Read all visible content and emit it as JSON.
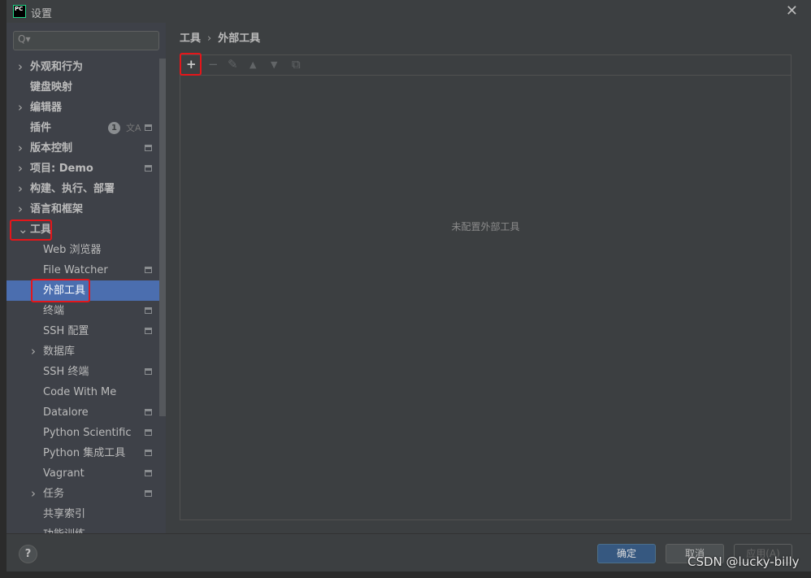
{
  "window": {
    "title": "设置",
    "logo": "PC",
    "close_icon": "close-icon"
  },
  "sidebar": {
    "search_placeholder": "Q▾",
    "items": [
      {
        "label": "外观和行为",
        "level": 0,
        "expandable": true,
        "expanded": false
      },
      {
        "label": "键盘映射",
        "level": 0,
        "expandable": false
      },
      {
        "label": "编辑器",
        "level": 0,
        "expandable": true,
        "expanded": false
      },
      {
        "label": "插件",
        "level": 0,
        "expandable": false,
        "badge": "1",
        "has_translate_icon": true,
        "has_project_icon": true
      },
      {
        "label": "版本控制",
        "level": 0,
        "expandable": true,
        "has_project_icon": true
      },
      {
        "label": "项目: Demo",
        "level": 0,
        "expandable": true,
        "has_project_icon": true
      },
      {
        "label": "构建、执行、部署",
        "level": 0,
        "expandable": true
      },
      {
        "label": "语言和框架",
        "level": 0,
        "expandable": true
      },
      {
        "label": "工具",
        "level": 0,
        "expandable": true,
        "expanded": true
      },
      {
        "label": "Web 浏览器",
        "level": 1
      },
      {
        "label": "File Watcher",
        "level": 1,
        "has_project_icon": true
      },
      {
        "label": "外部工具",
        "level": 1,
        "selected": true
      },
      {
        "label": "终端",
        "level": 1,
        "has_project_icon": true
      },
      {
        "label": "SSH 配置",
        "level": 1,
        "has_project_icon": true
      },
      {
        "label": "数据库",
        "level": 1,
        "expandable": true
      },
      {
        "label": "SSH 终端",
        "level": 1,
        "has_project_icon": true
      },
      {
        "label": "Code With Me",
        "level": 1
      },
      {
        "label": "Datalore",
        "level": 1,
        "has_project_icon": true
      },
      {
        "label": "Python Scientific",
        "level": 1,
        "has_project_icon": true
      },
      {
        "label": "Python 集成工具",
        "level": 1,
        "has_project_icon": true
      },
      {
        "label": "Vagrant",
        "level": 1,
        "has_project_icon": true
      },
      {
        "label": "任务",
        "level": 1,
        "expandable": true,
        "has_project_icon": true
      },
      {
        "label": "共享索引",
        "level": 1
      },
      {
        "label": "功能训练",
        "level": 1
      }
    ]
  },
  "breadcrumb": {
    "parent": "工具",
    "separator": "›",
    "current": "外部工具"
  },
  "toolbar": {
    "add": "+",
    "remove": "−",
    "edit": "✎",
    "up": "▲",
    "down": "▼",
    "copy": "⧉"
  },
  "main": {
    "empty_text": "未配置外部工具"
  },
  "footer": {
    "help": "?",
    "ok": "确定",
    "cancel": "取消",
    "apply": "应用(A)"
  },
  "watermark": "CSDN @lucky-billy",
  "colors": {
    "selection": "#4b6eaf",
    "highlight": "#e4161a",
    "primary_button": "#365880"
  }
}
